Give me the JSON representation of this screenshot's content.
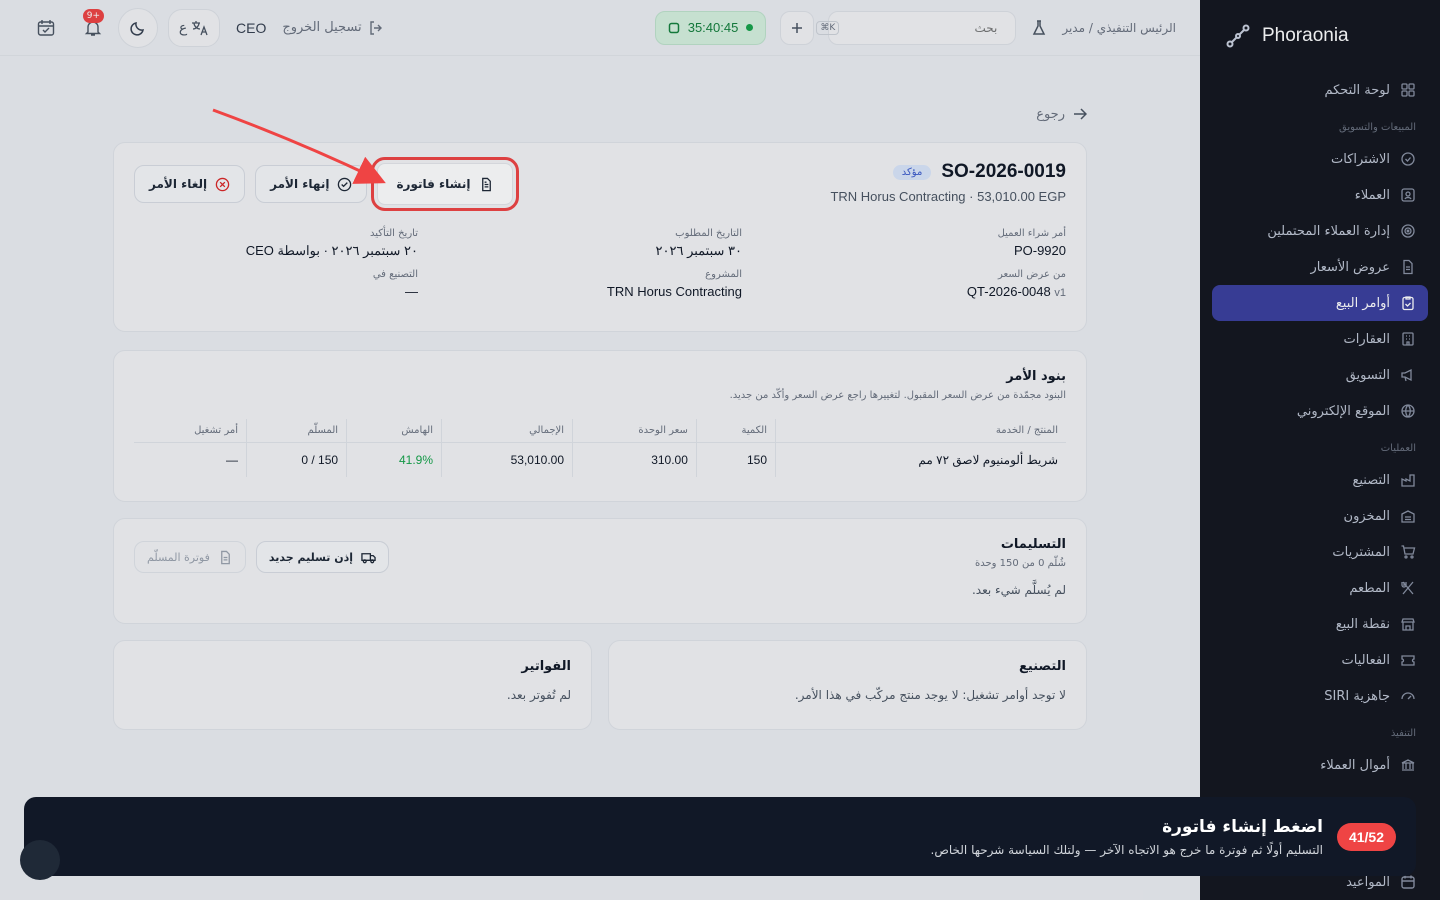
{
  "brand": {
    "name": "Phoraonia"
  },
  "header": {
    "breadcrumb": "الرئيس التنفيذي / مدير",
    "search_placeholder": "بحث",
    "kbd": "K⌘",
    "timer": "35:40:45",
    "notifications_badge": "+9",
    "lang_label": "ع",
    "user": "CEO",
    "logout": "تسجيل الخروج"
  },
  "sidebar": {
    "items": [
      {
        "label": "لوحة التحكم",
        "icon": "grid-icon",
        "type": "item"
      },
      {
        "label": "المبيعات والتسويق",
        "type": "group"
      },
      {
        "label": "الاشتراكات",
        "icon": "check-circle-icon",
        "type": "item"
      },
      {
        "label": "العملاء",
        "icon": "contacts-icon",
        "type": "item"
      },
      {
        "label": "إدارة العملاء المحتملين",
        "icon": "target-icon",
        "type": "item"
      },
      {
        "label": "عروض الأسعار",
        "icon": "file-icon",
        "type": "item"
      },
      {
        "label": "أوامر البيع",
        "icon": "clipboard-icon",
        "type": "item",
        "active": true
      },
      {
        "label": "العقارات",
        "icon": "building-icon",
        "type": "item"
      },
      {
        "label": "التسويق",
        "icon": "megaphone-icon",
        "type": "item"
      },
      {
        "label": "الموقع الإلكتروني",
        "icon": "globe-icon",
        "type": "item"
      },
      {
        "label": "العمليات",
        "type": "group"
      },
      {
        "label": "التصنيع",
        "icon": "factory-icon",
        "type": "item"
      },
      {
        "label": "المخزون",
        "icon": "warehouse-icon",
        "type": "item"
      },
      {
        "label": "المشتريات",
        "icon": "cart-icon",
        "type": "item"
      },
      {
        "label": "المطعم",
        "icon": "utensils-icon",
        "type": "item"
      },
      {
        "label": "نقطة البيع",
        "icon": "store-icon",
        "type": "item"
      },
      {
        "label": "الفعاليات",
        "icon": "ticket-icon",
        "type": "item"
      },
      {
        "label": "جاهزية SIRI",
        "icon": "gauge-icon",
        "type": "item"
      },
      {
        "label": "التنفيذ",
        "type": "group"
      },
      {
        "label": "أموال العملاء",
        "icon": "bank-icon",
        "type": "item"
      }
    ],
    "bottom_item": "المواعيد"
  },
  "main": {
    "back": "رجوع",
    "order": {
      "id": "SO-2026-0019",
      "status": "مؤكد",
      "subtitle": "TRN Horus Contracting · 53,010.00 EGP",
      "actions": {
        "create_invoice": "إنشاء فاتورة",
        "finish_order": "إنهاء الأمر",
        "cancel_order": "إلغاء الأمر"
      },
      "meta": [
        {
          "key": "أمر شراء العميل",
          "value": "PO-9920"
        },
        {
          "key": "التاريخ المطلوب",
          "value": "٣٠ سبتمبر ٢٠٢٦"
        },
        {
          "key": "تاريخ التأكيد",
          "value": "٢٠ سبتمبر ٢٠٢٦ · بواسطة CEO"
        },
        {
          "key": "من عرض السعر",
          "value": "QT-2026-0048",
          "version": "v1"
        },
        {
          "key": "المشروع",
          "value": "TRN Horus Contracting"
        },
        {
          "key": "التصنيع في",
          "value": "—"
        }
      ]
    },
    "lines": {
      "title": "بنود الأمر",
      "subtitle": "البنود مجمّدة من عرض السعر المقبول. لتغييرها راجع عرض السعر وأكّد من جديد.",
      "columns": [
        "المنتج / الخدمة",
        "الكمية",
        "سعر الوحدة",
        "الإجمالي",
        "الهامش",
        "المسلّم",
        "أمر تشغيل"
      ],
      "rows": [
        [
          "شريط ألومنيوم لاصق ٧٢ مم",
          "150",
          "310.00",
          "53,010.00",
          "41.9%",
          "150 / 0",
          "—"
        ]
      ]
    },
    "deliveries": {
      "title": "التسليمات",
      "subtitle": "شُلّم 0 من 150 وحدة",
      "empty": "لم يُسلَّم شيء بعد.",
      "new_delivery": "إذن تسليم جديد",
      "invoice_delivered": "فوترة المسلّم"
    },
    "manufacturing": {
      "title": "التصنيع",
      "empty": "لا توجد أوامر تشغيل: لا يوجد منتج مركّب في هذا الأمر."
    },
    "invoices": {
      "title": "الفواتير",
      "empty": "لم تُفوتر بعد."
    }
  },
  "tour": {
    "count": "41/52",
    "title": "اضغط إنشاء فاتورة",
    "text": "التسليم أولًا ثم فوترة ما خرج هو الاتجاه الآخر — ولتلك السياسة شرحها الخاص."
  },
  "colors": {
    "accent": "#3b3f9e",
    "danger": "#ef4444",
    "success": "#16a34a"
  }
}
